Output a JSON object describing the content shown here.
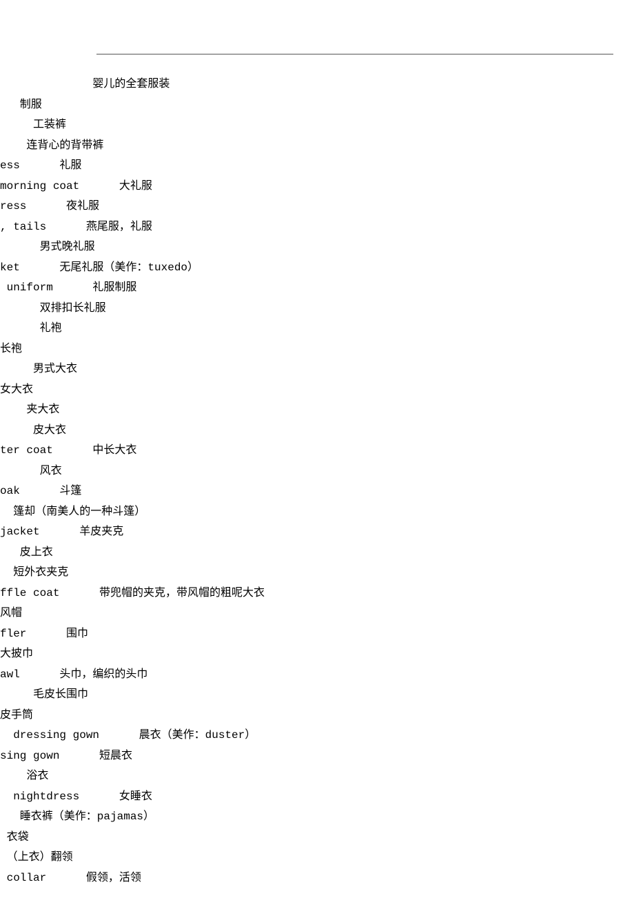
{
  "lines": [
    "              婴儿的全套服装",
    "   制服",
    "     工装裤",
    "    连背心的背带裤",
    "ess      礼服",
    "morning coat      大礼服",
    "ress      夜礼服",
    ", tails      燕尾服，礼服",
    "      男式晚礼服",
    "ket      无尾礼服（美作：tuxedo）",
    " uniform      礼服制服",
    "      双排扣长礼服",
    "      礼袍",
    "长袍",
    "     男式大衣",
    "女大衣",
    "    夹大衣",
    "     皮大衣",
    "ter coat      中长大衣",
    "      风衣",
    "oak      斗篷",
    "  篷却（南美人的一种斗篷）",
    "jacket      羊皮夹克",
    "   皮上衣",
    "  短外衣夹克",
    "ffle coat      带兜帽的夹克，带风帽的粗呢大衣",
    "风帽",
    "fler      围巾",
    "大披巾",
    "awl      头巾，编织的头巾",
    "     毛皮长围巾",
    "皮手筒",
    "  dressing gown      晨衣（美作：duster）",
    "sing gown      短晨衣",
    "    浴衣",
    "  nightdress      女睡衣",
    "   睡衣裤（美作：pajamas）",
    " 衣袋",
    " （上衣）翻领",
    " collar      假领，活领"
  ]
}
